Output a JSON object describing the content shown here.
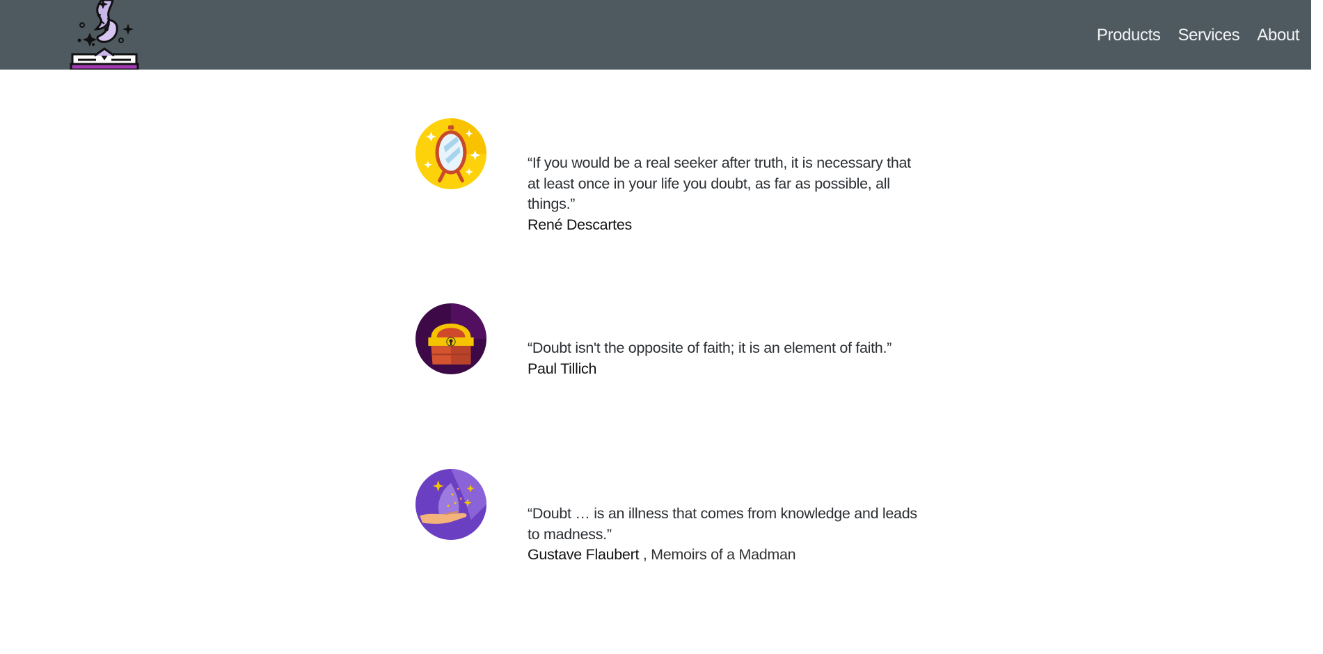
{
  "header": {
    "logo_icon": "spellbook-magic-icon",
    "nav": [
      {
        "label": "Products"
      },
      {
        "label": "Services"
      },
      {
        "label": "About"
      }
    ]
  },
  "quotes": [
    {
      "icon": "magic-mirror-icon",
      "text": "“If you would be a real seeker after truth, it is necessary that at least once in your life you doubt, as far as possible, all things.”",
      "author": "René Descartes",
      "source": ""
    },
    {
      "icon": "treasure-chest-icon",
      "text": "“Doubt isn't the opposite of faith; it is an element of faith.”",
      "author": "Paul Tillich",
      "source": ""
    },
    {
      "icon": "magic-hand-icon",
      "text": "“Doubt … is an illness that comes from knowledge and leads to madness.”",
      "author": "Gustave Flaubert",
      "source": ", Memoirs of a Madman"
    }
  ],
  "colors": {
    "header_bg": "#4f5a60",
    "nav_text": "#f2f4f5"
  }
}
